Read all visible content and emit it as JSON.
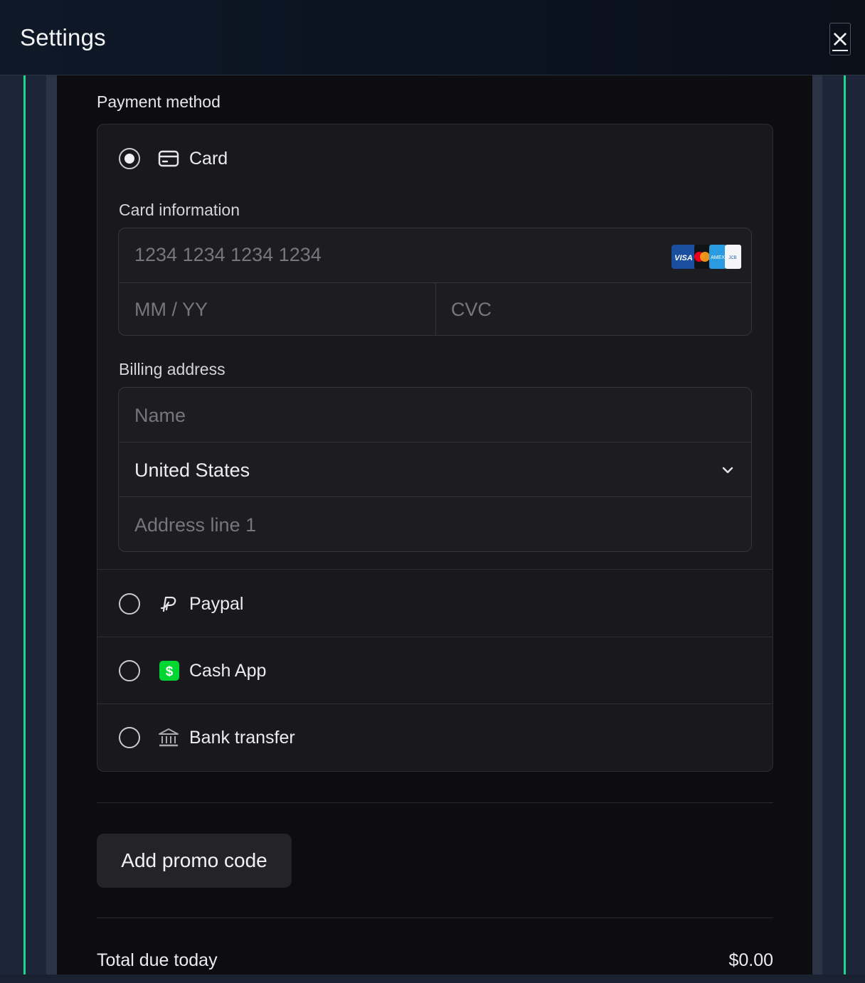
{
  "header": {
    "title": "Settings",
    "close_icon": "close-icon"
  },
  "payment": {
    "section_label": "Payment method",
    "methods": [
      {
        "label": "Card",
        "icon": "credit-card-icon",
        "selected": true
      },
      {
        "label": "Paypal",
        "icon": "paypal-icon",
        "selected": false
      },
      {
        "label": "Cash App",
        "icon": "cash-app-icon",
        "selected": false
      },
      {
        "label": "Bank transfer",
        "icon": "bank-icon",
        "selected": false
      }
    ],
    "card_info": {
      "label": "Card information",
      "number_placeholder": "1234 1234 1234 1234",
      "expiry_placeholder": "MM / YY",
      "cvc_placeholder": "CVC",
      "brands": [
        "VISA",
        "mastercard",
        "amex",
        "jcb"
      ]
    },
    "billing": {
      "label": "Billing address",
      "name_placeholder": "Name",
      "country": "United States",
      "address_placeholder": "Address line 1"
    }
  },
  "promo": {
    "button_label": "Add promo code"
  },
  "total": {
    "label": "Total due today",
    "amount": "$0.00"
  },
  "colors": {
    "accent_green": "#1ed68a",
    "cash_app_green": "#00d632",
    "visa_blue": "#1a4fa0",
    "amex_blue": "#2a9be0"
  }
}
